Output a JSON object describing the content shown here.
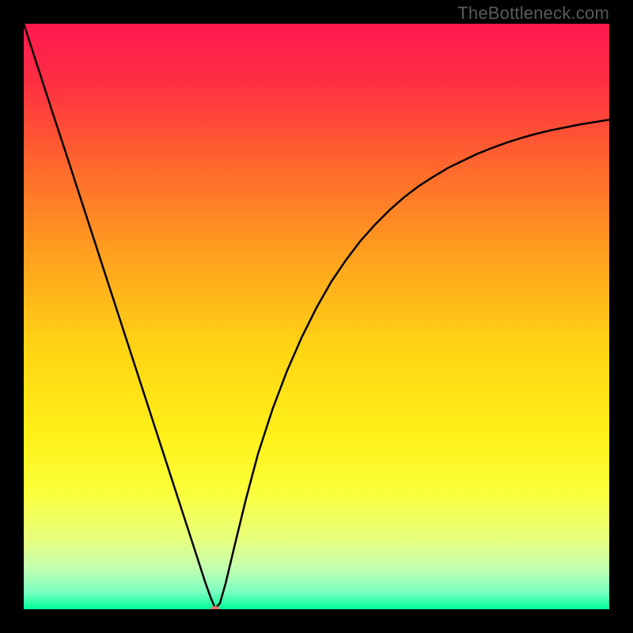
{
  "watermark": "TheBottleneck.com",
  "chart_data": {
    "type": "line",
    "title": "",
    "xlabel": "",
    "ylabel": "",
    "xlim": [
      0,
      100
    ],
    "ylim": [
      0,
      100
    ],
    "grid": false,
    "legend": false,
    "background_gradient": {
      "stops": [
        {
          "offset": 0.0,
          "color": "#ff1850"
        },
        {
          "offset": 0.1,
          "color": "#ff2f42"
        },
        {
          "offset": 0.25,
          "color": "#ff6a2c"
        },
        {
          "offset": 0.4,
          "color": "#ffa21e"
        },
        {
          "offset": 0.55,
          "color": "#ffd314"
        },
        {
          "offset": 0.7,
          "color": "#fff018"
        },
        {
          "offset": 0.8,
          "color": "#fbff3a"
        },
        {
          "offset": 0.88,
          "color": "#e8ff7e"
        },
        {
          "offset": 0.93,
          "color": "#c3ffb0"
        },
        {
          "offset": 0.97,
          "color": "#7affc0"
        },
        {
          "offset": 1.0,
          "color": "#00ff99"
        }
      ]
    },
    "series": [
      {
        "name": "curve",
        "color": "#000000",
        "width": 2.5,
        "x": [
          0.0,
          2.5,
          5.0,
          7.5,
          10.0,
          12.5,
          15.0,
          17.5,
          20.0,
          22.5,
          25.0,
          27.5,
          30.0,
          31.0,
          32.0,
          32.7,
          33.5,
          34.5,
          36.0,
          38.0,
          40.0,
          42.5,
          45.0,
          47.5,
          50.0,
          52.5,
          55.0,
          57.5,
          60.0,
          62.5,
          65.0,
          67.5,
          70.0,
          72.5,
          75.0,
          77.5,
          80.0,
          82.5,
          85.0,
          87.5,
          90.0,
          92.5,
          95.0,
          97.5,
          100.0
        ],
        "y": [
          100.0,
          92.3,
          84.6,
          77.0,
          69.3,
          61.6,
          53.9,
          46.2,
          38.5,
          30.8,
          23.1,
          15.4,
          7.7,
          4.6,
          1.8,
          0.2,
          1.0,
          4.5,
          10.8,
          19.0,
          26.5,
          34.2,
          40.8,
          46.5,
          51.5,
          55.9,
          59.6,
          62.9,
          65.7,
          68.2,
          70.4,
          72.3,
          73.9,
          75.4,
          76.6,
          77.8,
          78.8,
          79.7,
          80.5,
          81.2,
          81.8,
          82.3,
          82.8,
          83.2,
          83.6
        ]
      }
    ],
    "marker": {
      "x": 32.7,
      "y": 0.0,
      "color": "#e57368",
      "rx": 6,
      "ry": 4
    }
  }
}
